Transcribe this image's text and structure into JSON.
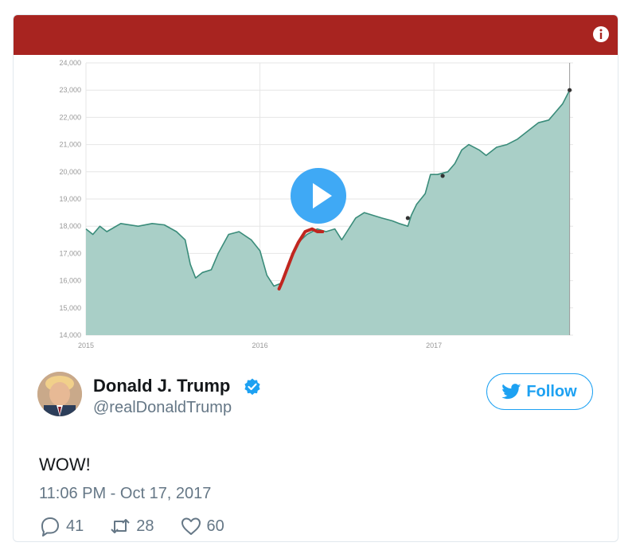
{
  "video": {
    "accent_color": "#a82420",
    "play_icon": "play-icon",
    "info_icon": "info-icon",
    "chart_data": {
      "type": "area",
      "title": "",
      "xlabel": "",
      "ylabel": "",
      "x_ticks": [
        "2015",
        "2016",
        "2017"
      ],
      "y_ticks": [
        "14,000",
        "15,000",
        "16,000",
        "17,000",
        "18,000",
        "19,000",
        "20,000",
        "21,000",
        "22,000",
        "23,000",
        "24,000"
      ],
      "xlim": [
        2015.0,
        2017.8
      ],
      "ylim": [
        14000,
        24000
      ],
      "grid": true,
      "series": [
        {
          "color": "#3a8c7a",
          "fill": "#a9cfc7",
          "points": [
            [
              2015.0,
              17900
            ],
            [
              2015.04,
              17700
            ],
            [
              2015.08,
              18000
            ],
            [
              2015.12,
              17800
            ],
            [
              2015.2,
              18100
            ],
            [
              2015.3,
              18000
            ],
            [
              2015.38,
              18100
            ],
            [
              2015.45,
              18050
            ],
            [
              2015.52,
              17800
            ],
            [
              2015.57,
              17500
            ],
            [
              2015.6,
              16600
            ],
            [
              2015.63,
              16100
            ],
            [
              2015.67,
              16300
            ],
            [
              2015.72,
              16400
            ],
            [
              2015.76,
              17000
            ],
            [
              2015.82,
              17700
            ],
            [
              2015.88,
              17800
            ],
            [
              2015.95,
              17500
            ],
            [
              2016.0,
              17100
            ],
            [
              2016.04,
              16200
            ],
            [
              2016.08,
              15800
            ],
            [
              2016.12,
              15900
            ],
            [
              2016.14,
              16200
            ],
            [
              2016.18,
              16800
            ],
            [
              2016.22,
              17400
            ],
            [
              2016.27,
              17700
            ],
            [
              2016.33,
              17900
            ],
            [
              2016.38,
              17800
            ],
            [
              2016.43,
              17900
            ],
            [
              2016.47,
              17500
            ],
            [
              2016.5,
              17800
            ],
            [
              2016.55,
              18300
            ],
            [
              2016.6,
              18500
            ],
            [
              2016.65,
              18400
            ],
            [
              2016.7,
              18300
            ],
            [
              2016.76,
              18200
            ],
            [
              2016.8,
              18100
            ],
            [
              2016.85,
              18000
            ],
            [
              2016.87,
              18400
            ],
            [
              2016.9,
              18800
            ],
            [
              2016.95,
              19200
            ],
            [
              2016.98,
              19900
            ],
            [
              2017.02,
              19900
            ],
            [
              2017.08,
              20000
            ],
            [
              2017.12,
              20300
            ],
            [
              2017.16,
              20800
            ],
            [
              2017.2,
              21000
            ],
            [
              2017.26,
              20800
            ],
            [
              2017.3,
              20600
            ],
            [
              2017.36,
              20900
            ],
            [
              2017.42,
              21000
            ],
            [
              2017.48,
              21200
            ],
            [
              2017.54,
              21500
            ],
            [
              2017.6,
              21800
            ],
            [
              2017.66,
              21900
            ],
            [
              2017.7,
              22200
            ],
            [
              2017.74,
              22500
            ],
            [
              2017.78,
              23000
            ]
          ]
        },
        {
          "color": "#c0261f",
          "points": [
            [
              2016.11,
              15700
            ],
            [
              2016.13,
              16000
            ],
            [
              2016.16,
              16500
            ],
            [
              2016.19,
              17000
            ],
            [
              2016.22,
              17400
            ],
            [
              2016.26,
              17800
            ],
            [
              2016.3,
              17900
            ],
            [
              2016.33,
              17800
            ],
            [
              2016.36,
              17800
            ]
          ]
        }
      ],
      "markers": [
        {
          "x": 2016.85,
          "y": 18300
        },
        {
          "x": 2017.05,
          "y": 19850
        },
        {
          "x": 2017.78,
          "y": 23000
        }
      ]
    }
  },
  "tweet": {
    "display_name": "Donald J. Trump",
    "screen_name": "@realDonaldTrump",
    "verified_icon": "verified-badge-icon",
    "follow_label": "Follow",
    "text": "WOW!",
    "timestamp": "11:06 PM - Oct 17, 2017",
    "replies": "41",
    "retweets": "28",
    "likes": "60",
    "brand_color": "#1da1f2"
  }
}
